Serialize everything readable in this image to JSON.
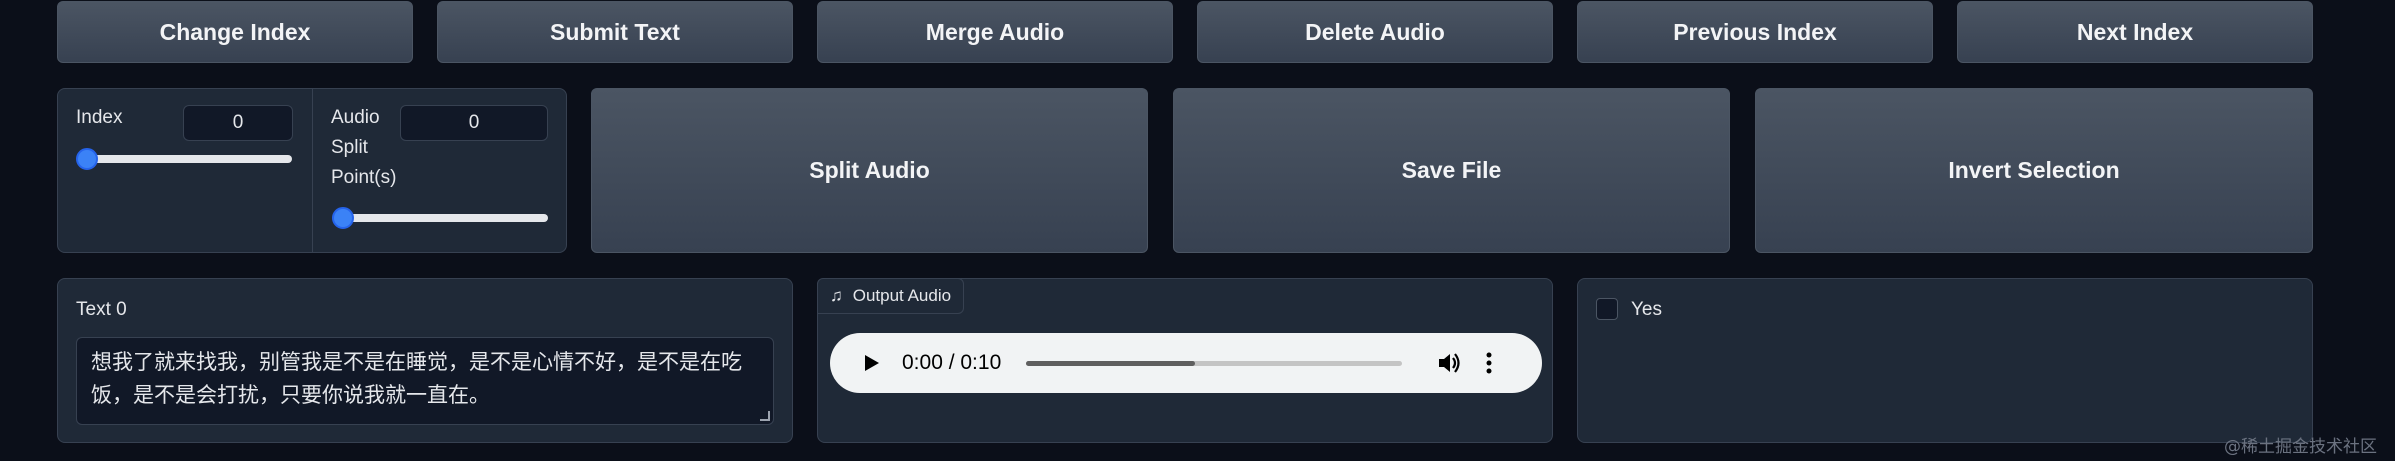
{
  "toolbar": {
    "change_index": "Change Index",
    "submit_text": "Submit Text",
    "merge_audio": "Merge Audio",
    "delete_audio": "Delete Audio",
    "previous_index": "Previous Index",
    "next_index": "Next Index"
  },
  "controls": {
    "index_label": "Index",
    "index_value": "0",
    "audio_split_label_1": "Audio",
    "audio_split_label_2": "Split",
    "audio_split_label_3": "Point(s)",
    "audio_split_value": "0",
    "index_slider_level": 0,
    "split_slider_level": 0
  },
  "actions": {
    "split_audio": "Split Audio",
    "save_file": "Save File",
    "invert_selection": "Invert Selection"
  },
  "text_panel": {
    "label": "Text 0",
    "value": "想我了就来找我，别管我是不是在睡觉，是不是心情不好，是不是在吃饭，是不是会打扰，只要你说我就一直在。"
  },
  "audio_panel": {
    "tab_label": "Output Audio",
    "time_display": "0:00 / 0:10",
    "progress_fraction": 0.45
  },
  "checkbox_panel": {
    "label": "Yes",
    "checked": false
  },
  "watermark": "@稀土掘金技术社区",
  "colors": {
    "background": "#0b0f19",
    "panel": "#1f2937",
    "button": "#4b5563",
    "accent": "#3b82f6"
  }
}
